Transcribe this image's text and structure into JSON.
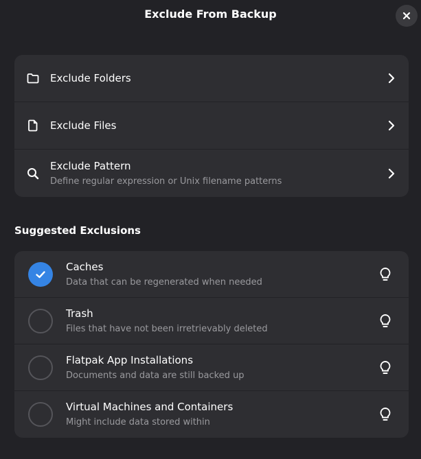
{
  "window": {
    "title": "Exclude From Backup"
  },
  "actions": [
    {
      "title": "Exclude Folders",
      "subtitle": ""
    },
    {
      "title": "Exclude Files",
      "subtitle": ""
    },
    {
      "title": "Exclude Pattern",
      "subtitle": "Define regular expression or Unix filename patterns"
    }
  ],
  "suggested": {
    "heading": "Suggested Exclusions",
    "items": [
      {
        "title": "Caches",
        "subtitle": "Data that can be regenerated when needed",
        "checked": true
      },
      {
        "title": "Trash",
        "subtitle": "Files that have not been irretrievably deleted",
        "checked": false
      },
      {
        "title": "Flatpak App Installations",
        "subtitle": "Documents and data are still backed up",
        "checked": false
      },
      {
        "title": "Virtual Machines and Containers",
        "subtitle": "Might include data stored within",
        "checked": false
      }
    ]
  },
  "colors": {
    "accent": "#3584e4",
    "background": "#222226",
    "card": "#2e2e32",
    "dim_text": "#9a9a9e"
  },
  "icons": [
    "close-icon",
    "folder-icon",
    "file-icon",
    "search-icon",
    "chevron-right-icon",
    "checkmark-icon",
    "lightbulb-icon"
  ]
}
